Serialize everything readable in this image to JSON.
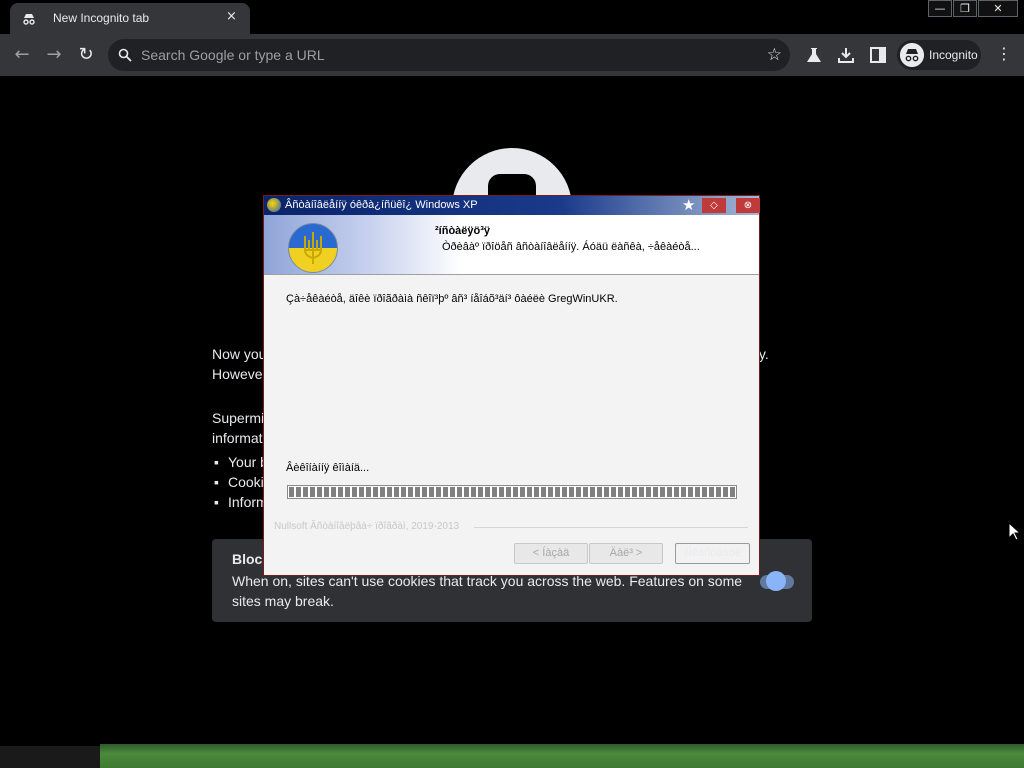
{
  "browser": {
    "tab": {
      "title": "New Incognito tab",
      "close_label": "×"
    },
    "window_controls": {
      "minimize": "—",
      "restore": "❐",
      "close": "✕"
    },
    "omnibox": {
      "placeholder": "Search Google or type a URL"
    },
    "profile_label": "Incognito",
    "icons": [
      "incognito-icon",
      "back-icon",
      "forward-icon",
      "reload-icon",
      "search-icon",
      "star-icon",
      "labs-icon",
      "download-icon",
      "side-panel-icon",
      "menu-icon"
    ]
  },
  "page": {
    "line1_start": "Now you",
    "line1_end": "ty.",
    "line2_start": "However",
    "line3_start": "Supermi",
    "line4_start": "informat",
    "bullets": [
      "Your b",
      "Cooki",
      "Inform"
    ],
    "cookie_card": {
      "title": "Block",
      "description": "When on, sites can't use cookies that track you across the web. Features on some sites may break.",
      "toggle_on": true
    }
  },
  "dialog": {
    "title": "Âñòàíîâëåííÿ óêðà¿íñüêî¿ Windows XP",
    "header_title": "²íñòàëÿö³ÿ",
    "header_subtitle": "Òðèâàº ïðîöåñ âñòàíîâëåííÿ. Áóäü ëàñêà, ÷åêàéòå...",
    "message": "Çà÷åêàéòå, äîêè ïðîãðàìà ñêîï³þº âñ³ íåîáõ³äí³ ôàéëè GregWinUKR.",
    "status": "Âèêîíàííÿ êîìàíä...",
    "progress": 1.0,
    "branding": "Nullsoft Âñòàíîâëþâà÷ ïðîãðàì, 2019-2013",
    "buttons": {
      "back": "< Íàçàä",
      "next": "Äàë³ >",
      "cancel": "Ñêàñóâàòè"
    },
    "controls": {
      "pin": "★",
      "restore": "◇",
      "close": "⊗"
    }
  }
}
